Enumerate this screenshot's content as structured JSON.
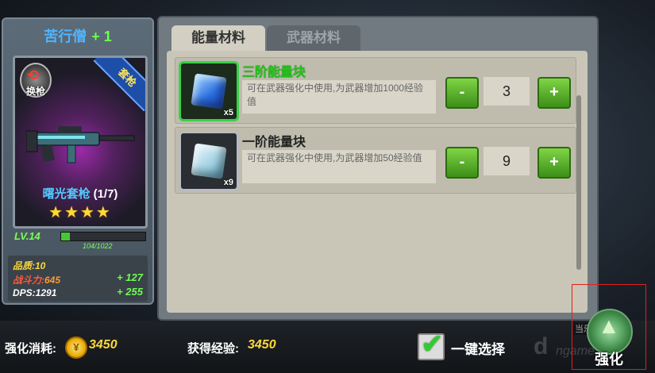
{
  "hero": {
    "name": "苦行僧",
    "level_bonus": "+ 1"
  },
  "weapon": {
    "swap_label": "换枪",
    "type_label": "套枪",
    "name": "曙光套枪",
    "count": "(1/7)",
    "stars": "★★★★",
    "level_label": "LV.14",
    "xp_text": "104/1022",
    "xp_fraction": 0.1
  },
  "stats": {
    "quality_label": "品质:",
    "quality_value": "10",
    "power_label": "战斗力:",
    "power_value": "645",
    "power_bonus": "+ 127",
    "dps_label": "DPS:",
    "dps_value": "1291",
    "dps_bonus": "+ 255"
  },
  "tabs": {
    "energy": "能量材料",
    "weapon": "武器材料"
  },
  "items": [
    {
      "title": "三阶能量块",
      "qty_badge": "x5",
      "desc": "可在武器强化中使用,为武器增加1000经验值",
      "minus": "-",
      "plus": "+",
      "selected": "3"
    },
    {
      "title": "一阶能量块",
      "qty_badge": "x9",
      "desc": "可在武器强化中使用,为武器增加50经验值",
      "minus": "-",
      "plus": "+",
      "selected": "9"
    }
  ],
  "footer": {
    "cost_label": "强化消耗:",
    "coin_symbol": "¥",
    "cost_value": "3450",
    "exp_label": "获得经验:",
    "exp_value": "3450",
    "select_all": "一键选择",
    "enhance_label": "强化"
  },
  "watermark": {
    "top": "当乐网游戏区",
    "site": "ngame",
    "letter": "d"
  },
  "colors": {
    "accent_green": "#3bd04a",
    "gold": "#ffd93a",
    "blue_name": "#4fb4ff"
  }
}
